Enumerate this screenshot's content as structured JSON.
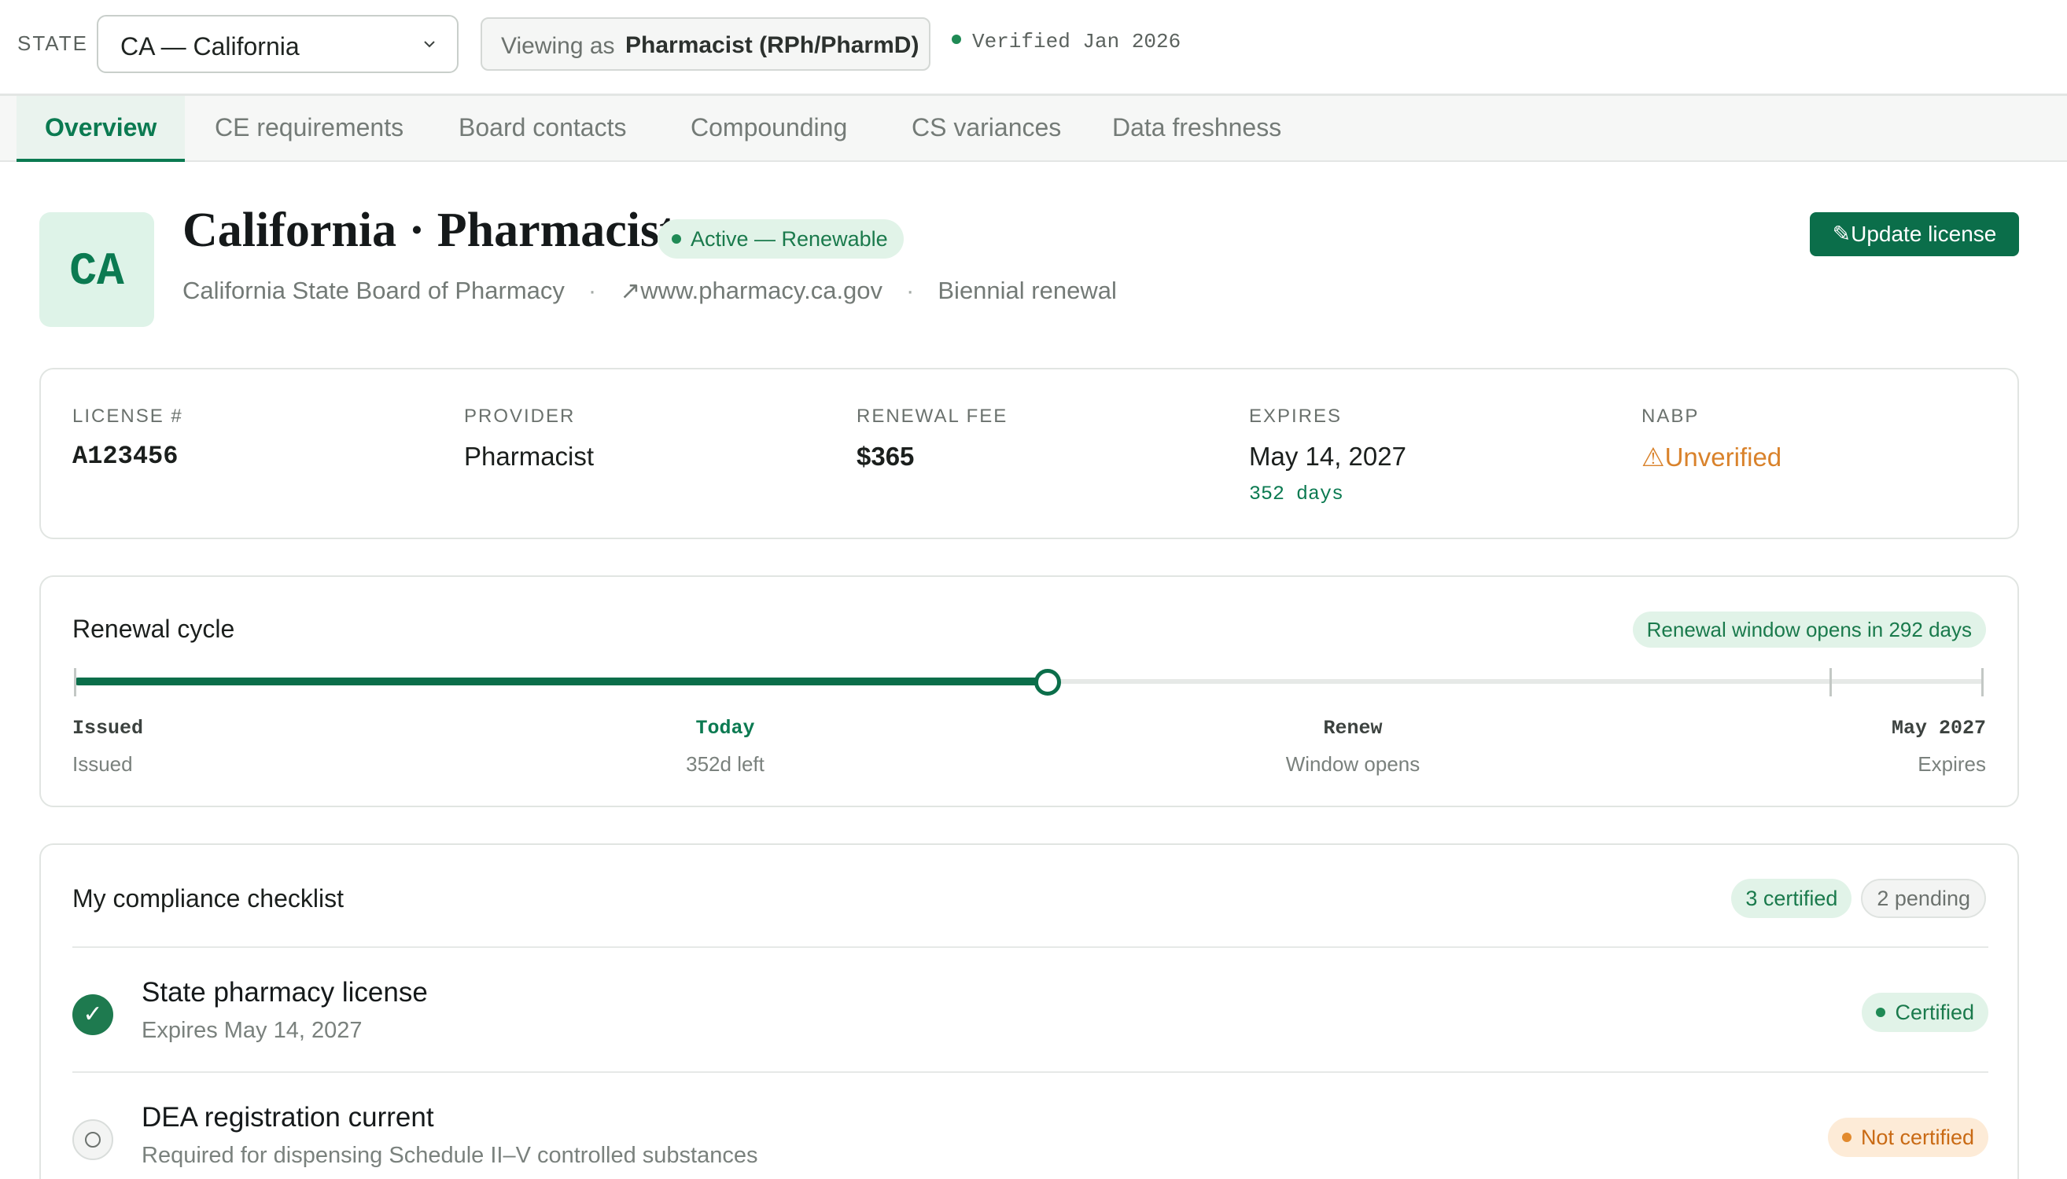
{
  "topbar": {
    "state_label": "STATE",
    "state_value": "CA — California",
    "viewing_label": "Viewing as",
    "viewing_role": "Pharmacist (RPh/PharmD)",
    "verified": "Verified Jan 2026"
  },
  "tabs": [
    {
      "label": "Overview",
      "active": true
    },
    {
      "label": "CE requirements"
    },
    {
      "label": "Board contacts"
    },
    {
      "label": "Compounding"
    },
    {
      "label": "CS variances"
    },
    {
      "label": "Data freshness"
    }
  ],
  "header": {
    "tile": "CA",
    "title": "California · Pharmacist",
    "status": "Active — Renewable",
    "board": "California State Board of Pharmacy",
    "website": "www.pharmacy.ca.gov",
    "renewal": "Biennial renewal",
    "update_button": "Update license"
  },
  "license_info": {
    "license_label": "LICENSE #",
    "license_value": "A123456",
    "provider_label": "PROVIDER",
    "provider_value": "Pharmacist",
    "fee_label": "RENEWAL FEE",
    "fee_value": "$365",
    "expires_label": "EXPIRES",
    "expires_value": "May 14, 2027",
    "expires_days": "352 days",
    "nabp_label": "NABP",
    "nabp_value": "Unverified"
  },
  "renewal_cycle": {
    "title": "Renewal cycle",
    "window_pill": "Renewal window opens in 292 days",
    "progress": 0.51,
    "milestones": [
      {
        "top": "Issued",
        "bottom": "Issued"
      },
      {
        "top": "Today",
        "bottom": "352d left"
      },
      {
        "top": "Renew",
        "bottom": "Window opens"
      },
      {
        "top": "May 2027",
        "bottom": "Expires"
      }
    ]
  },
  "checklist": {
    "title": "My compliance checklist",
    "certified_count": "3 certified",
    "pending_count": "2 pending",
    "items": [
      {
        "title": "State pharmacy license",
        "subtitle": "Expires May 14, 2027",
        "status": "Certified"
      },
      {
        "title": "DEA registration current",
        "subtitle": "Required for dispensing Schedule II–V controlled substances",
        "status": "Not certified"
      }
    ]
  },
  "colors": {
    "accent": "#0b7a51",
    "button": "#0b6e4a",
    "warning": "#d9822b"
  }
}
